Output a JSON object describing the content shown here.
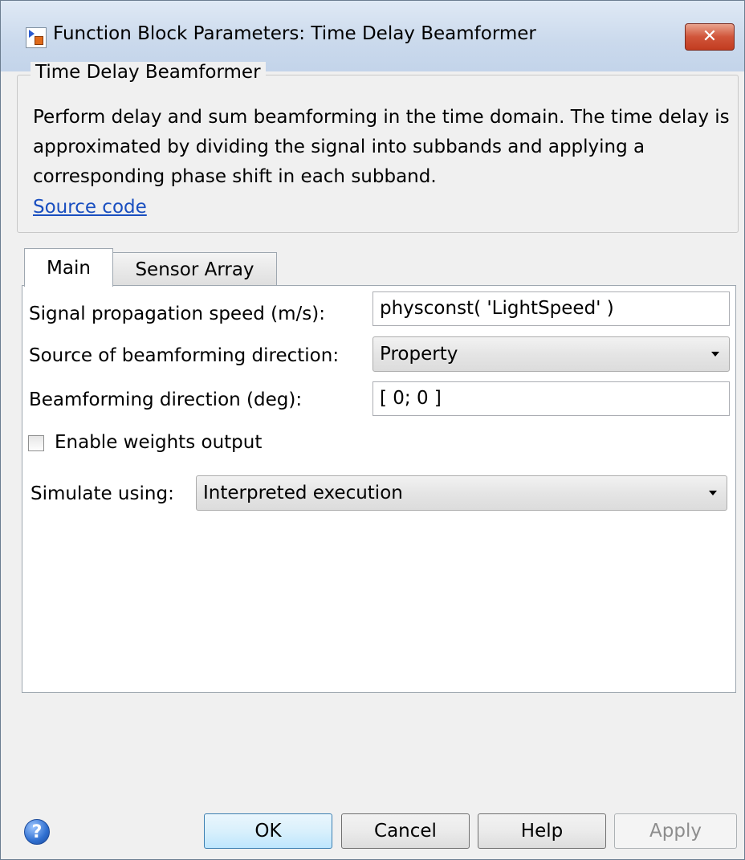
{
  "window": {
    "title": "Function Block Parameters: Time Delay Beamformer",
    "close_label": "✕"
  },
  "group": {
    "title": "Time Delay Beamformer",
    "description": "Perform delay and sum beamforming in the time domain. The time delay is approximated by dividing the signal into subbands and applying a corresponding phase shift in each subband.",
    "link": "Source code"
  },
  "tabs": [
    {
      "label": "Main",
      "selected": true
    },
    {
      "label": "Sensor Array",
      "selected": false
    }
  ],
  "params": {
    "propagation_speed": {
      "label": "Signal propagation speed (m/s):",
      "value": "physconst( 'LightSpeed' )"
    },
    "direction_source": {
      "label": "Source of beamforming direction:",
      "value": "Property"
    },
    "direction": {
      "label": "Beamforming direction (deg):",
      "value": "[ 0; 0 ]"
    },
    "weights_output": {
      "label": "Enable weights output",
      "checked": false
    },
    "simulate_using": {
      "label": "Simulate using:",
      "value": "Interpreted execution"
    }
  },
  "footer": {
    "help_icon": "question-icon",
    "ok": "OK",
    "cancel": "Cancel",
    "help": "Help",
    "apply": "Apply"
  }
}
